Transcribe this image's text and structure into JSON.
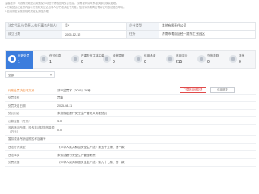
{
  "notes": [
    "温馨提示：可按照行政处罚类别及事项进行筛选查询处罚信息，如有疑问请联系相关部门核实处理。",
    "2.行政处罚决定书内容以行政机关送达当事人的书面决定书为准，信息公示期间如有异议可依法提出申请。",
    "3.信用修复请按照相关规定及流程办理。"
  ],
  "info": {
    "row1": {
      "l1": "法定代表人(负责人/执行事务合伙人)",
      "v1": "吴*",
      "l2": "企业类型",
      "v2": "其他有限责任公司"
    },
    "row2": {
      "l1": "成立日期",
      "v1": "2005-12-12",
      "l2": "住所",
      "v2": "济南市槐荫区经十路东工业园区"
    }
  },
  "stats": [
    {
      "title": "行政处罚",
      "count": "1"
    },
    {
      "title": "许可信息",
      "count": "1"
    },
    {
      "title": "严重失信主体名单",
      "count": "0"
    },
    {
      "title": "经营异常",
      "count": "0"
    },
    {
      "title": "信用承诺",
      "count": "0"
    },
    {
      "title": "信用评价",
      "count": "215"
    },
    {
      "title": "守信激励",
      "count": "0"
    },
    {
      "title": "其他",
      "count": "0"
    }
  ],
  "filter": {
    "selected": "全部"
  },
  "detail": {
    "decision_no_label": "行政处罚决定书文号",
    "decision_no": "济市监罚字〔2025〕26号",
    "btn_download": "下载信用修复表",
    "btn_repair": "信用修复",
    "rows": [
      {
        "label": "处罚类别",
        "value": "罚款"
      },
      {
        "label": "处罚决定日期",
        "value": "2025-08-11"
      },
      {
        "label": "处罚内容",
        "value": "未按规定履行安全生产管理义务被处罚"
      },
      {
        "label": "罚款金额（万元）",
        "value": "4.0"
      },
      {
        "label": "没收违法所得、没收非法财物的金额（万元）",
        "value": "0.0"
      },
      {
        "label": "暂扣或者吊销证照名称及编号",
        "value": ""
      },
      {
        "label": "违法行为类型",
        "value": "《中华人民共和国安全生产法》第五十五条、第一款"
      },
      {
        "label": "违法事实",
        "value": "未依法履行安全生产管理职责"
      },
      {
        "label": "处罚依据",
        "value": "《中华人民共和国安全生产法》第九十七条、第一款"
      }
    ]
  }
}
